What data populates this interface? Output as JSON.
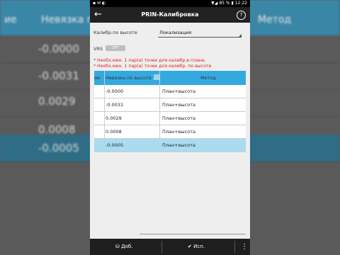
{
  "status_bar": {
    "time": "12:22",
    "battery": "85 %"
  },
  "app_bar": {
    "title": "PRIN-Калибровка",
    "help": "?"
  },
  "form": {
    "calib_label": "Калибр.по высоте",
    "calib_value": "Локализация",
    "vrs_label": "VRS",
    "vrs_toggle": "OFF"
  },
  "warnings": [
    "* Необх.мин. 1 пар(а) точек для калибр.в плане.",
    "* Необх.мин. 1 пар(а) точек для калибр. по высоте"
  ],
  "table": {
    "columns": [
      "ие",
      "Невязка по высоте",
      "Метод"
    ],
    "rows": [
      {
        "residual": "-0.0000",
        "method": "План+высота",
        "selected": false
      },
      {
        "residual": "-0.0031",
        "method": "План+высота",
        "selected": false
      },
      {
        "residual": "0.0029",
        "method": "План+высота",
        "selected": false
      },
      {
        "residual": "0.0008",
        "method": "План+высота",
        "selected": false
      },
      {
        "residual": "-0.0005",
        "method": "План+высота",
        "selected": true
      }
    ]
  },
  "bottom_bar": {
    "add_label": "Доб.",
    "done_label": "Исп."
  },
  "background": {
    "columns": [
      "ие",
      "Невязка по высоте",
      "Метод"
    ],
    "values": [
      "-0.0000",
      "-0.0031",
      "0.0029",
      "0.0008",
      "-0.0005"
    ]
  },
  "colors": {
    "header": "#34a9de",
    "selected_row": "#a9dcf0",
    "warning": "#e02020",
    "app_bar": "#222222"
  }
}
